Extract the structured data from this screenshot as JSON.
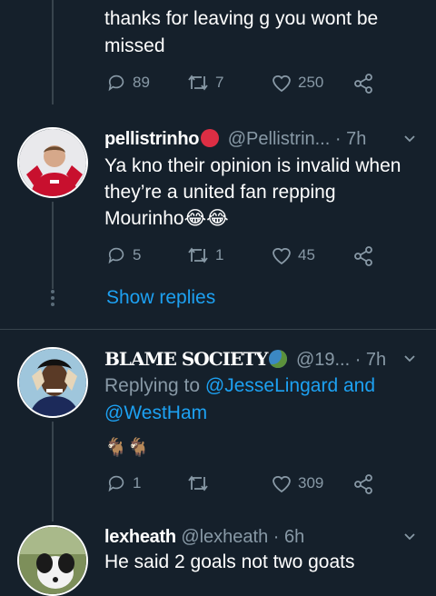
{
  "tweet0": {
    "text_line1": "thanks for leaving g you wont be",
    "text_line2": "missed",
    "replies": "89",
    "retweets": "7",
    "likes": "250"
  },
  "tweet1": {
    "name": "pellistrinho",
    "handle": "@Pellistrin...",
    "time": "· 7h",
    "text_line1": "Ya kno their opinion is invalid when",
    "text_line2": "they’re a united fan repping",
    "text_line3": "Mourinho",
    "emoji": "😂😂",
    "replies": "5",
    "retweets": "1",
    "likes": "45",
    "show_replies": "Show replies"
  },
  "tweet2": {
    "name": "BLAME SOCIETY",
    "handle": "@19...",
    "time": "· 7h",
    "replying_prefix": "Replying to",
    "reply_to_1": "@JesseLingard",
    "reply_and": "and",
    "reply_to_2": "@WestHam",
    "emoji": "🐐🐐",
    "replies": "1",
    "retweets": "",
    "likes": "309"
  },
  "tweet3": {
    "name": "lexheath",
    "handle": "@lexheath",
    "time": "· 6h",
    "text": "He said 2 goals not two goats"
  },
  "colors": {
    "background": "#15202b",
    "text": "#ffffff",
    "muted": "#8899a6",
    "link": "#1da1f2",
    "divider": "#38444d"
  }
}
